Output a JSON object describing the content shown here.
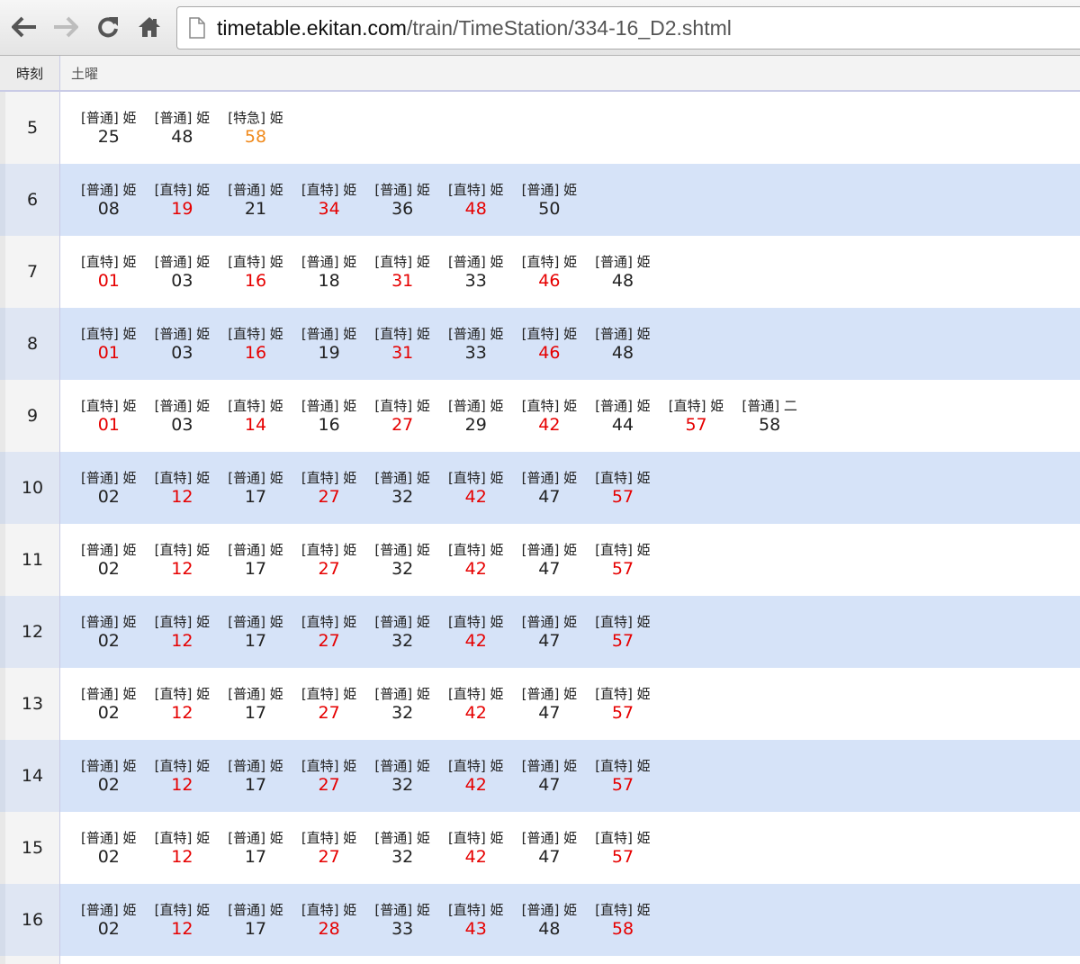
{
  "browser": {
    "url_host": "timetable.ekitan.com",
    "url_path": "/train/TimeStation/334-16_D2.shtml",
    "icons": [
      "back-arrow-icon",
      "forward-arrow-icon",
      "reload-icon",
      "home-icon",
      "page-icon"
    ]
  },
  "colors": {
    "rapid": "#e60000",
    "express": "#f08a1c",
    "local": "#222222",
    "alt_row": "#d6e3f8"
  },
  "table": {
    "hour_header": "時刻",
    "day_header": "土曜",
    "rows": [
      {
        "hour": "5",
        "trains": [
          {
            "label": "[普通] 姫",
            "minute": "25",
            "kind": "local"
          },
          {
            "label": "[普通] 姫",
            "minute": "48",
            "kind": "local"
          },
          {
            "label": "[特急] 姫",
            "minute": "58",
            "kind": "express"
          }
        ]
      },
      {
        "hour": "6",
        "trains": [
          {
            "label": "[普通] 姫",
            "minute": "08",
            "kind": "local"
          },
          {
            "label": "[直特] 姫",
            "minute": "19",
            "kind": "rapid"
          },
          {
            "label": "[普通] 姫",
            "minute": "21",
            "kind": "local"
          },
          {
            "label": "[直特] 姫",
            "minute": "34",
            "kind": "rapid"
          },
          {
            "label": "[普通] 姫",
            "minute": "36",
            "kind": "local"
          },
          {
            "label": "[直特] 姫",
            "minute": "48",
            "kind": "rapid"
          },
          {
            "label": "[普通] 姫",
            "minute": "50",
            "kind": "local"
          }
        ]
      },
      {
        "hour": "7",
        "trains": [
          {
            "label": "[直特] 姫",
            "minute": "01",
            "kind": "rapid"
          },
          {
            "label": "[普通] 姫",
            "minute": "03",
            "kind": "local"
          },
          {
            "label": "[直特] 姫",
            "minute": "16",
            "kind": "rapid"
          },
          {
            "label": "[普通] 姫",
            "minute": "18",
            "kind": "local"
          },
          {
            "label": "[直特] 姫",
            "minute": "31",
            "kind": "rapid"
          },
          {
            "label": "[普通] 姫",
            "minute": "33",
            "kind": "local"
          },
          {
            "label": "[直特] 姫",
            "minute": "46",
            "kind": "rapid"
          },
          {
            "label": "[普通] 姫",
            "minute": "48",
            "kind": "local"
          }
        ]
      },
      {
        "hour": "8",
        "trains": [
          {
            "label": "[直特] 姫",
            "minute": "01",
            "kind": "rapid"
          },
          {
            "label": "[普通] 姫",
            "minute": "03",
            "kind": "local"
          },
          {
            "label": "[直特] 姫",
            "minute": "16",
            "kind": "rapid"
          },
          {
            "label": "[普通] 姫",
            "minute": "19",
            "kind": "local"
          },
          {
            "label": "[直特] 姫",
            "minute": "31",
            "kind": "rapid"
          },
          {
            "label": "[普通] 姫",
            "minute": "33",
            "kind": "local"
          },
          {
            "label": "[直特] 姫",
            "minute": "46",
            "kind": "rapid"
          },
          {
            "label": "[普通] 姫",
            "minute": "48",
            "kind": "local"
          }
        ]
      },
      {
        "hour": "9",
        "trains": [
          {
            "label": "[直特] 姫",
            "minute": "01",
            "kind": "rapid"
          },
          {
            "label": "[普通] 姫",
            "minute": "03",
            "kind": "local"
          },
          {
            "label": "[直特] 姫",
            "minute": "14",
            "kind": "rapid"
          },
          {
            "label": "[普通] 姫",
            "minute": "16",
            "kind": "local"
          },
          {
            "label": "[直特] 姫",
            "minute": "27",
            "kind": "rapid"
          },
          {
            "label": "[普通] 姫",
            "minute": "29",
            "kind": "local"
          },
          {
            "label": "[直特] 姫",
            "minute": "42",
            "kind": "rapid"
          },
          {
            "label": "[普通] 姫",
            "minute": "44",
            "kind": "local"
          },
          {
            "label": "[直特] 姫",
            "minute": "57",
            "kind": "rapid"
          },
          {
            "label": "[普通] 二",
            "minute": "58",
            "kind": "local"
          }
        ]
      },
      {
        "hour": "10",
        "trains": [
          {
            "label": "[普通] 姫",
            "minute": "02",
            "kind": "local"
          },
          {
            "label": "[直特] 姫",
            "minute": "12",
            "kind": "rapid"
          },
          {
            "label": "[普通] 姫",
            "minute": "17",
            "kind": "local"
          },
          {
            "label": "[直特] 姫",
            "minute": "27",
            "kind": "rapid"
          },
          {
            "label": "[普通] 姫",
            "minute": "32",
            "kind": "local"
          },
          {
            "label": "[直特] 姫",
            "minute": "42",
            "kind": "rapid"
          },
          {
            "label": "[普通] 姫",
            "minute": "47",
            "kind": "local"
          },
          {
            "label": "[直特] 姫",
            "minute": "57",
            "kind": "rapid"
          }
        ]
      },
      {
        "hour": "11",
        "trains": [
          {
            "label": "[普通] 姫",
            "minute": "02",
            "kind": "local"
          },
          {
            "label": "[直特] 姫",
            "minute": "12",
            "kind": "rapid"
          },
          {
            "label": "[普通] 姫",
            "minute": "17",
            "kind": "local"
          },
          {
            "label": "[直特] 姫",
            "minute": "27",
            "kind": "rapid"
          },
          {
            "label": "[普通] 姫",
            "minute": "32",
            "kind": "local"
          },
          {
            "label": "[直特] 姫",
            "minute": "42",
            "kind": "rapid"
          },
          {
            "label": "[普通] 姫",
            "minute": "47",
            "kind": "local"
          },
          {
            "label": "[直特] 姫",
            "minute": "57",
            "kind": "rapid"
          }
        ]
      },
      {
        "hour": "12",
        "trains": [
          {
            "label": "[普通] 姫",
            "minute": "02",
            "kind": "local"
          },
          {
            "label": "[直特] 姫",
            "minute": "12",
            "kind": "rapid"
          },
          {
            "label": "[普通] 姫",
            "minute": "17",
            "kind": "local"
          },
          {
            "label": "[直特] 姫",
            "minute": "27",
            "kind": "rapid"
          },
          {
            "label": "[普通] 姫",
            "minute": "32",
            "kind": "local"
          },
          {
            "label": "[直特] 姫",
            "minute": "42",
            "kind": "rapid"
          },
          {
            "label": "[普通] 姫",
            "minute": "47",
            "kind": "local"
          },
          {
            "label": "[直特] 姫",
            "minute": "57",
            "kind": "rapid"
          }
        ]
      },
      {
        "hour": "13",
        "trains": [
          {
            "label": "[普通] 姫",
            "minute": "02",
            "kind": "local"
          },
          {
            "label": "[直特] 姫",
            "minute": "12",
            "kind": "rapid"
          },
          {
            "label": "[普通] 姫",
            "minute": "17",
            "kind": "local"
          },
          {
            "label": "[直特] 姫",
            "minute": "27",
            "kind": "rapid"
          },
          {
            "label": "[普通] 姫",
            "minute": "32",
            "kind": "local"
          },
          {
            "label": "[直特] 姫",
            "minute": "42",
            "kind": "rapid"
          },
          {
            "label": "[普通] 姫",
            "minute": "47",
            "kind": "local"
          },
          {
            "label": "[直特] 姫",
            "minute": "57",
            "kind": "rapid"
          }
        ]
      },
      {
        "hour": "14",
        "trains": [
          {
            "label": "[普通] 姫",
            "minute": "02",
            "kind": "local"
          },
          {
            "label": "[直特] 姫",
            "minute": "12",
            "kind": "rapid"
          },
          {
            "label": "[普通] 姫",
            "minute": "17",
            "kind": "local"
          },
          {
            "label": "[直特] 姫",
            "minute": "27",
            "kind": "rapid"
          },
          {
            "label": "[普通] 姫",
            "minute": "32",
            "kind": "local"
          },
          {
            "label": "[直特] 姫",
            "minute": "42",
            "kind": "rapid"
          },
          {
            "label": "[普通] 姫",
            "minute": "47",
            "kind": "local"
          },
          {
            "label": "[直特] 姫",
            "minute": "57",
            "kind": "rapid"
          }
        ]
      },
      {
        "hour": "15",
        "trains": [
          {
            "label": "[普通] 姫",
            "minute": "02",
            "kind": "local"
          },
          {
            "label": "[直特] 姫",
            "minute": "12",
            "kind": "rapid"
          },
          {
            "label": "[普通] 姫",
            "minute": "17",
            "kind": "local"
          },
          {
            "label": "[直特] 姫",
            "minute": "27",
            "kind": "rapid"
          },
          {
            "label": "[普通] 姫",
            "minute": "32",
            "kind": "local"
          },
          {
            "label": "[直特] 姫",
            "minute": "42",
            "kind": "rapid"
          },
          {
            "label": "[普通] 姫",
            "minute": "47",
            "kind": "local"
          },
          {
            "label": "[直特] 姫",
            "minute": "57",
            "kind": "rapid"
          }
        ]
      },
      {
        "hour": "16",
        "trains": [
          {
            "label": "[普通] 姫",
            "minute": "02",
            "kind": "local"
          },
          {
            "label": "[直特] 姫",
            "minute": "12",
            "kind": "rapid"
          },
          {
            "label": "[普通] 姫",
            "minute": "17",
            "kind": "local"
          },
          {
            "label": "[直特] 姫",
            "minute": "28",
            "kind": "rapid"
          },
          {
            "label": "[普通] 姫",
            "minute": "33",
            "kind": "local"
          },
          {
            "label": "[直特] 姫",
            "minute": "43",
            "kind": "rapid"
          },
          {
            "label": "[普通] 姫",
            "minute": "48",
            "kind": "local"
          },
          {
            "label": "[直特] 姫",
            "minute": "58",
            "kind": "rapid"
          }
        ]
      }
    ]
  }
}
